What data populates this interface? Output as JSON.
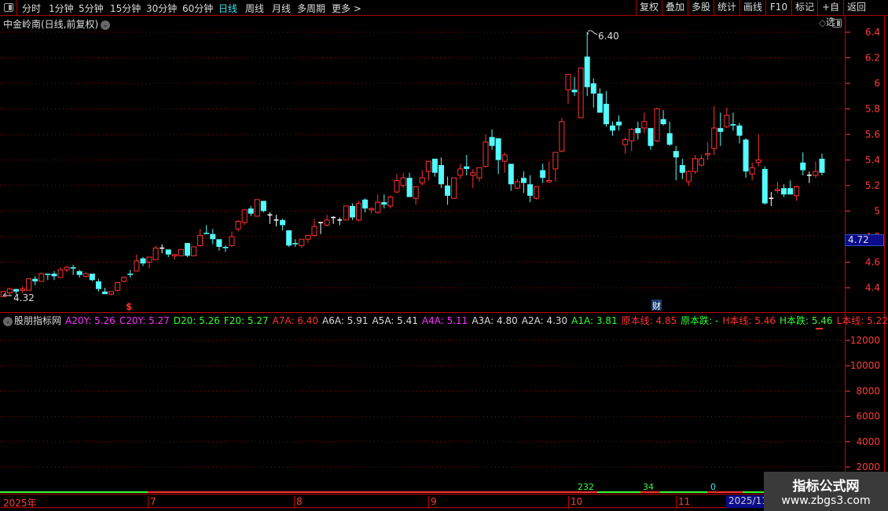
{
  "toolbar": {
    "periods": [
      "分时",
      "1分钟",
      "5分钟",
      "15分钟",
      "30分钟",
      "60分钟",
      "日线",
      "周线",
      "月线",
      "多周期",
      "更多 >"
    ],
    "active_period": "日线",
    "right_buttons": [
      "复权",
      "叠加",
      "多股",
      "统计",
      "画线",
      "F10",
      "标记",
      "+自选",
      "返回"
    ]
  },
  "stock": {
    "title": "中金岭南(日线,前复权)"
  },
  "indicator": {
    "name": "股朋指标网",
    "values": [
      {
        "label": "A20Y: 5.26",
        "color": "#ff32ff"
      },
      {
        "label": "C20Y: 5.27",
        "color": "#ff32ff"
      },
      {
        "label": "D20: 5.26",
        "color": "#32ff32"
      },
      {
        "label": "F20: 5.27",
        "color": "#32ff32"
      },
      {
        "label": "A7A: 6.40",
        "color": "#ff3232"
      },
      {
        "label": "A6A: 5.91",
        "color": "#dddddd"
      },
      {
        "label": "A5A: 5.41",
        "color": "#dddddd"
      },
      {
        "label": "A4A: 5.11",
        "color": "#ff32ff"
      },
      {
        "label": "A3A: 4.80",
        "color": "#dddddd"
      },
      {
        "label": "A2A: 4.30",
        "color": "#dddddd"
      },
      {
        "label": "A1A: 3.81",
        "color": "#32ff32"
      },
      {
        "label": "原本线: 4.85",
        "color": "#ff3232"
      },
      {
        "label": "原本跌: -",
        "color": "#32ff32"
      },
      {
        "label": "H本线: 5.46",
        "color": "#ff3232"
      },
      {
        "label": "H本跌: 5.46",
        "color": "#32ff32"
      },
      {
        "label": "L本线: 5.22",
        "color": "#ff3232"
      },
      {
        "label": "L本跌:",
        "color": "#32ff32"
      }
    ]
  },
  "current_price": "4.72",
  "markers": {
    "high_label": "6.40",
    "low_label": "4.32",
    "dollar": "$",
    "fin": "财"
  },
  "bottom_counts": [
    {
      "text": "232",
      "color": "#32ff32"
    },
    {
      "text": "34",
      "color": "#32ff32"
    },
    {
      "text": "0",
      "color": "#3ee6f0"
    }
  ],
  "dates": {
    "labels": [
      "2025年",
      "7",
      "8",
      "9",
      "10",
      "11"
    ],
    "current": "2025/11/"
  },
  "watermark": {
    "line1": "指标公式网",
    "line2": "www.zbgs3.com"
  },
  "colors": {
    "up": "#ff3232",
    "down": "#54fcfc",
    "flat": "#ffffff",
    "axis": "#ff3c3c",
    "grid": "#a00000"
  },
  "chart_data": {
    "type": "candlestick",
    "price_axis": {
      "ticks": [
        6.4,
        6.2,
        6.0,
        5.8,
        5.6,
        5.4,
        5.2,
        5.0,
        4.8,
        4.6,
        4.4
      ],
      "range": [
        4.4,
        6.4
      ]
    },
    "volume_axis": {
      "ticks": [
        12000,
        10000,
        8000,
        6000,
        4000,
        2000
      ]
    },
    "grid": true,
    "ohlc": [
      [
        4.33,
        4.37,
        4.33,
        4.37
      ],
      [
        4.36,
        4.4,
        4.34,
        4.39
      ],
      [
        4.39,
        4.39,
        4.35,
        4.37
      ],
      [
        4.38,
        4.41,
        4.36,
        4.39
      ],
      [
        4.38,
        4.47,
        4.38,
        4.47
      ],
      [
        4.47,
        4.49,
        4.42,
        4.45
      ],
      [
        4.45,
        4.52,
        4.45,
        4.51
      ],
      [
        4.51,
        4.51,
        4.46,
        4.5
      ],
      [
        4.51,
        4.53,
        4.46,
        4.49
      ],
      [
        4.48,
        4.56,
        4.48,
        4.54
      ],
      [
        4.54,
        4.57,
        4.52,
        4.56
      ],
      [
        4.56,
        4.58,
        4.5,
        4.55
      ],
      [
        4.53,
        4.54,
        4.48,
        4.5
      ],
      [
        4.49,
        4.52,
        4.48,
        4.51
      ],
      [
        4.51,
        4.51,
        4.45,
        4.46
      ],
      [
        4.45,
        4.47,
        4.37,
        4.39
      ],
      [
        4.37,
        4.4,
        4.35,
        4.35
      ],
      [
        4.35,
        4.37,
        4.34,
        4.37
      ],
      [
        4.38,
        4.44,
        4.37,
        4.44
      ],
      [
        4.45,
        4.49,
        4.44,
        4.48
      ],
      [
        4.51,
        4.54,
        4.48,
        4.5
      ],
      [
        4.53,
        4.66,
        4.53,
        4.61
      ],
      [
        4.63,
        4.64,
        4.57,
        4.59
      ],
      [
        4.6,
        4.64,
        4.55,
        4.64
      ],
      [
        4.62,
        4.73,
        4.62,
        4.71
      ],
      [
        4.71,
        4.74,
        4.67,
        4.71
      ],
      [
        4.7,
        4.7,
        4.64,
        4.66
      ],
      [
        4.65,
        4.66,
        4.62,
        4.66
      ],
      [
        4.65,
        4.7,
        4.65,
        4.7
      ],
      [
        4.75,
        4.75,
        4.64,
        4.65
      ],
      [
        4.65,
        4.72,
        4.65,
        4.72
      ],
      [
        4.73,
        4.86,
        4.72,
        4.81
      ],
      [
        4.83,
        4.89,
        4.82,
        4.82
      ],
      [
        4.82,
        4.86,
        4.74,
        4.78
      ],
      [
        4.78,
        4.78,
        4.69,
        4.72
      ],
      [
        4.72,
        4.73,
        4.68,
        4.71
      ],
      [
        4.73,
        4.84,
        4.72,
        4.8
      ],
      [
        4.86,
        4.93,
        4.84,
        4.92
      ],
      [
        4.91,
        5.01,
        4.89,
        5.01
      ],
      [
        5.02,
        5.04,
        4.96,
        4.98
      ],
      [
        4.96,
        5.09,
        4.96,
        5.09
      ],
      [
        5.08,
        5.08,
        4.99,
        5.0
      ],
      [
        4.97,
        4.99,
        4.9,
        4.97
      ],
      [
        4.93,
        4.97,
        4.88,
        4.93
      ],
      [
        4.93,
        4.94,
        4.85,
        4.89
      ],
      [
        4.85,
        4.85,
        4.72,
        4.73
      ],
      [
        4.75,
        4.78,
        4.72,
        4.74
      ],
      [
        4.73,
        4.78,
        4.71,
        4.78
      ],
      [
        4.78,
        4.81,
        4.75,
        4.81
      ],
      [
        4.81,
        4.94,
        4.8,
        4.88
      ],
      [
        4.91,
        4.91,
        4.82,
        4.91
      ],
      [
        4.89,
        4.97,
        4.88,
        4.93
      ],
      [
        4.95,
        4.96,
        4.9,
        4.95
      ],
      [
        4.93,
        4.95,
        4.89,
        4.93
      ],
      [
        4.93,
        5.04,
        4.93,
        5.04
      ],
      [
        5.04,
        5.06,
        4.93,
        4.95
      ],
      [
        4.93,
        5.08,
        4.92,
        5.06
      ],
      [
        5.09,
        5.1,
        4.99,
        5.02
      ],
      [
        5.01,
        5.03,
        4.98,
        5.02
      ],
      [
        4.99,
        5.13,
        4.98,
        5.07
      ],
      [
        5.07,
        5.13,
        5.02,
        5.05
      ],
      [
        5.04,
        5.12,
        5.02,
        5.11
      ],
      [
        5.15,
        5.29,
        5.14,
        5.24
      ],
      [
        5.2,
        5.3,
        5.18,
        5.26
      ],
      [
        5.26,
        5.3,
        5.11,
        5.11
      ],
      [
        5.1,
        5.19,
        5.05,
        5.19
      ],
      [
        5.22,
        5.32,
        5.2,
        5.26
      ],
      [
        5.31,
        5.39,
        5.24,
        5.39
      ],
      [
        5.41,
        5.41,
        5.27,
        5.3
      ],
      [
        5.36,
        5.42,
        5.18,
        5.21
      ],
      [
        5.2,
        5.27,
        5.05,
        5.12
      ],
      [
        5.1,
        5.26,
        5.1,
        5.26
      ],
      [
        5.28,
        5.37,
        5.25,
        5.33
      ],
      [
        5.35,
        5.44,
        5.28,
        5.33
      ],
      [
        5.28,
        5.33,
        5.18,
        5.3
      ],
      [
        5.26,
        5.34,
        5.23,
        5.34
      ],
      [
        5.35,
        5.6,
        5.34,
        5.54
      ],
      [
        5.58,
        5.64,
        5.48,
        5.51
      ],
      [
        5.57,
        5.57,
        5.29,
        5.4
      ],
      [
        5.39,
        5.46,
        5.3,
        5.44
      ],
      [
        5.37,
        5.37,
        5.16,
        5.21
      ],
      [
        5.18,
        5.25,
        5.17,
        5.23
      ],
      [
        5.26,
        5.31,
        5.14,
        5.22
      ],
      [
        5.21,
        5.28,
        5.07,
        5.12
      ],
      [
        5.1,
        5.19,
        5.09,
        5.19
      ],
      [
        5.32,
        5.37,
        5.22,
        5.26
      ],
      [
        5.23,
        5.39,
        5.22,
        5.24
      ],
      [
        5.33,
        5.46,
        5.23,
        5.46
      ],
      [
        5.47,
        5.73,
        5.46,
        5.7
      ],
      [
        5.95,
        6.07,
        5.84,
        6.07
      ],
      [
        5.95,
        6.05,
        5.9,
        5.93
      ],
      [
        5.73,
        6.12,
        5.73,
        6.12
      ],
      [
        6.21,
        6.4,
        5.9,
        5.97
      ],
      [
        6.0,
        6.04,
        5.81,
        5.92
      ],
      [
        5.92,
        5.96,
        5.77,
        5.77
      ],
      [
        5.84,
        5.94,
        5.66,
        5.68
      ],
      [
        5.67,
        5.7,
        5.59,
        5.63
      ],
      [
        5.7,
        5.75,
        5.63,
        5.67
      ],
      [
        5.52,
        5.58,
        5.45,
        5.56
      ],
      [
        5.55,
        5.65,
        5.47,
        5.64
      ],
      [
        5.65,
        5.7,
        5.56,
        5.61
      ],
      [
        5.65,
        5.77,
        5.61,
        5.7
      ],
      [
        5.65,
        5.65,
        5.48,
        5.51
      ],
      [
        5.55,
        5.81,
        5.54,
        5.8
      ],
      [
        5.72,
        5.79,
        5.67,
        5.68
      ],
      [
        5.61,
        5.7,
        5.51,
        5.52
      ],
      [
        5.47,
        5.51,
        5.24,
        5.42
      ],
      [
        5.36,
        5.41,
        5.25,
        5.3
      ],
      [
        5.23,
        5.32,
        5.2,
        5.31
      ],
      [
        5.31,
        5.44,
        5.29,
        5.41
      ],
      [
        5.36,
        5.44,
        5.35,
        5.41
      ],
      [
        5.44,
        5.54,
        5.4,
        5.45
      ],
      [
        5.49,
        5.82,
        5.44,
        5.65
      ],
      [
        5.65,
        5.77,
        5.51,
        5.62
      ],
      [
        5.66,
        5.81,
        5.65,
        5.75
      ],
      [
        5.68,
        5.77,
        5.63,
        5.67
      ],
      [
        5.67,
        5.69,
        5.53,
        5.59
      ],
      [
        5.56,
        5.57,
        5.26,
        5.31
      ],
      [
        5.29,
        5.38,
        5.24,
        5.34
      ],
      [
        5.38,
        5.6,
        5.35,
        5.4
      ],
      [
        5.33,
        5.35,
        5.05,
        5.06
      ],
      [
        5.1,
        5.15,
        5.04,
        5.1
      ],
      [
        5.16,
        5.23,
        5.14,
        5.17
      ],
      [
        5.18,
        5.21,
        5.11,
        5.13
      ],
      [
        5.18,
        5.24,
        5.13,
        5.13
      ],
      [
        5.12,
        5.2,
        5.08,
        5.19
      ],
      [
        5.38,
        5.46,
        5.28,
        5.32
      ],
      [
        5.28,
        5.31,
        5.22,
        5.28
      ],
      [
        5.28,
        5.39,
        5.26,
        5.31
      ],
      [
        5.41,
        5.45,
        5.28,
        5.3
      ]
    ]
  }
}
